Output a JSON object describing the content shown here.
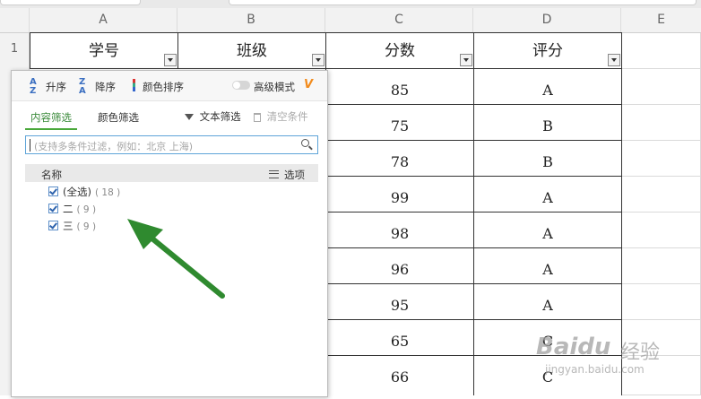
{
  "columns": [
    "A",
    "B",
    "C",
    "D",
    "E"
  ],
  "row_numbers": [
    "1"
  ],
  "header": {
    "col_a": "学号",
    "col_b": "班级",
    "col_c": "分数",
    "col_d": "评分"
  },
  "rows": [
    {
      "score": "85",
      "grade": "A"
    },
    {
      "score": "75",
      "grade": "B"
    },
    {
      "score": "78",
      "grade": "B"
    },
    {
      "score": "99",
      "grade": "A"
    },
    {
      "score": "98",
      "grade": "A"
    },
    {
      "score": "96",
      "grade": "A"
    },
    {
      "score": "95",
      "grade": "A"
    },
    {
      "score": "65",
      "grade": "C"
    },
    {
      "score": "66",
      "grade": "C"
    }
  ],
  "filter_panel": {
    "sort_asc": "升序",
    "sort_desc": "降序",
    "color_sort": "颜色排序",
    "advanced_mode": "高级模式",
    "tab_content": "内容筛选",
    "tab_color": "颜色筛选",
    "text_filter": "文本筛选",
    "clear_conditions": "清空条件",
    "search_placeholder": "(支持多条件过滤，例如：北京  上海)",
    "list_header": "名称",
    "options_label": "选项",
    "items": [
      {
        "label": "(全选)",
        "count": "( 18 )",
        "checked": true
      },
      {
        "label": "二",
        "count": "( 9 )",
        "checked": true
      },
      {
        "label": "三",
        "count": "( 9 )",
        "checked": true
      }
    ]
  },
  "watermark": {
    "brand": "Baidu",
    "text": "经验",
    "url": "jingyan.baidu.com"
  },
  "colors": {
    "accent_green": "#3a8a3a",
    "arrow_green": "#2f8a2f",
    "tab_underline": "#49a83a",
    "search_border": "#5ea4d8"
  }
}
